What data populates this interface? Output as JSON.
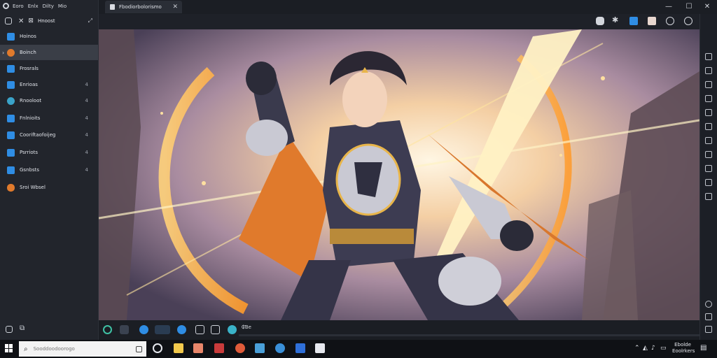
{
  "menubar": {
    "items": [
      "Eoro",
      "Enlx",
      "Dilty",
      "Mio"
    ]
  },
  "sidebar": {
    "header": "Hnoost",
    "items": [
      {
        "label": "Hoinos",
        "count": ""
      },
      {
        "label": "Boinch",
        "count": ""
      },
      {
        "label": "Frosrals",
        "count": ""
      },
      {
        "label": "Enrioas",
        "count": "4"
      },
      {
        "label": "Rnooloot",
        "count": "4"
      },
      {
        "label": "Fnlnioits",
        "count": "4"
      },
      {
        "label": "Cooriftaofoijeg",
        "count": "4"
      },
      {
        "label": "Psrriots",
        "count": "4"
      },
      {
        "label": "Gsnbsts",
        "count": "4"
      },
      {
        "label": "Sroi Wbsel",
        "count": ""
      }
    ]
  },
  "tab": {
    "title": "Fbodiorbolorismo",
    "close": "✕"
  },
  "window": {
    "minimize": "—",
    "maximize": "☐",
    "close": "✕"
  },
  "bottom": {
    "label": "₲Ɓe"
  },
  "taskbar": {
    "search_placeholder": "Sooddoodoorogo",
    "tray_time": "Ebolde",
    "tray_date": "Eoolrkers"
  },
  "colors": {
    "accent": "#2f8de4",
    "orange": "#e07a2c",
    "bg": "#22252c"
  },
  "icons": {
    "search": "search-icon",
    "windows": "windows-logo-icon"
  }
}
